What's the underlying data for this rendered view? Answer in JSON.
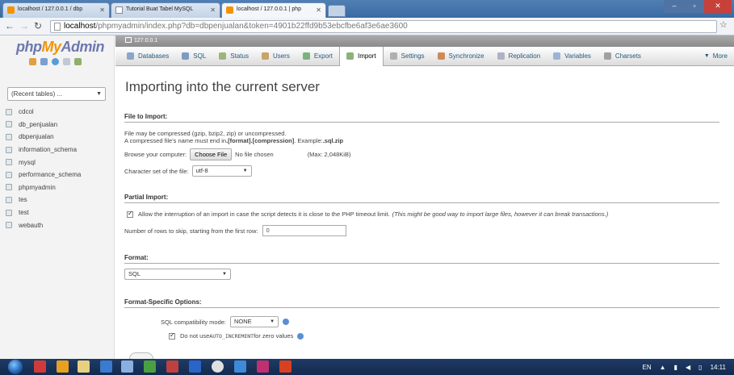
{
  "browser": {
    "tabs": [
      {
        "label": "localhost / 127.0.0.1 / dbp",
        "active": false
      },
      {
        "label": "Tutorial Buat Tabel MySQL",
        "active": false
      },
      {
        "label": "localhost / 127.0.0.1 | php",
        "active": true
      }
    ],
    "url_host": "localhost",
    "url_path": "/phpmyadmin/index.php?db=dbpenjualan&token=4901b22ffd9b53ebcfbe6af3e6ae3600"
  },
  "sidebar": {
    "logo": {
      "php": "php",
      "my": "My",
      "admin": "Admin"
    },
    "recent_label": "(Recent tables) ...",
    "databases": [
      "cdcol",
      "db_penjualan",
      "dbpenjualan",
      "information_schema",
      "mysql",
      "performance_schema",
      "phpmyadmin",
      "tes",
      "test",
      "webauth"
    ]
  },
  "server_label": "127.0.0.1",
  "menu_tabs": [
    {
      "label": "Databases",
      "icon": "database-icon",
      "color": "#8aa6c8"
    },
    {
      "label": "SQL",
      "icon": "sql-icon",
      "color": "#7c9cc2"
    },
    {
      "label": "Status",
      "icon": "status-icon",
      "color": "#9fb57a"
    },
    {
      "label": "Users",
      "icon": "users-icon",
      "color": "#c9a36a"
    },
    {
      "label": "Export",
      "icon": "export-icon",
      "color": "#7fb07f"
    },
    {
      "label": "Import",
      "icon": "import-icon",
      "color": "#8ab27a"
    },
    {
      "label": "Settings",
      "icon": "settings-icon",
      "color": "#b0b0b0"
    },
    {
      "label": "Synchronize",
      "icon": "synchronize-icon",
      "color": "#d08a5a"
    },
    {
      "label": "Replication",
      "icon": "replication-icon",
      "color": "#b0b0c8"
    },
    {
      "label": "Variables",
      "icon": "variables-icon",
      "color": "#9ab4d6"
    },
    {
      "label": "Charsets",
      "icon": "charsets-icon",
      "color": "#a0a0a0"
    },
    {
      "label": "More",
      "icon": "chevron-down-icon",
      "color": "#666666"
    }
  ],
  "page": {
    "title": "Importing into the current server",
    "file_section": {
      "heading": "File to Import:",
      "note1": "File may be compressed (gzip, bzip2, zip) or uncompressed.",
      "note2_a": "A compressed file's name must end in ",
      "note2_b": ".[format].[compression]",
      "note2_c": ". Example: ",
      "note2_d": ".sql.zip",
      "browse_label": "Browse your computer:",
      "choose_button": "Choose File",
      "no_file": "No file chosen",
      "max": "(Max: 2,048KiB)",
      "charset_label": "Character set of the file:",
      "charset_value": "utf-8"
    },
    "partial_section": {
      "heading": "Partial Import:",
      "allow_text": "Allow the interruption of an import in case the script detects it is close to the PHP timeout limit.",
      "allow_hint": "(This might be good way to import large files, however it can break transactions.)",
      "skip_label": "Number of rows to skip, starting from the first row:",
      "skip_value": "0"
    },
    "format_section": {
      "heading": "Format:",
      "format_value": "SQL"
    },
    "options_section": {
      "heading": "Format-Specific Options:",
      "compat_label": "SQL compatibility mode:",
      "compat_value": "NONE",
      "auto_a": "Do not use ",
      "auto_b": "AUTO_INCREMENT",
      "auto_c": " for zero values"
    }
  },
  "taskbar": {
    "lang": "EN",
    "time": "14:11"
  }
}
